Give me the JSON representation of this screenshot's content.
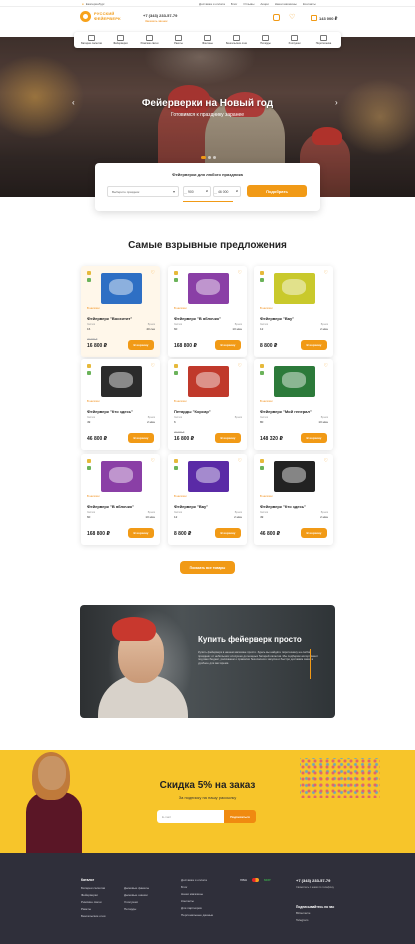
{
  "topbar": {
    "city": "Екатеринбург",
    "links": [
      "Доставка и оплата",
      "Блог",
      "Отзывы",
      "Акции",
      "Наши магазины",
      "Контакты"
    ]
  },
  "header": {
    "logo_line1": "РУССКИЙ",
    "logo_line2": "ФЕЙЕРВЕРК",
    "phone": "+7 (343) 233-57-79",
    "callback": "Заказать звонок",
    "cart_total": "143 000 ₽"
  },
  "categories": [
    "Батареи салютов",
    "Фейерверки",
    "Римские свечи",
    "Ракеты",
    "Фонтаны",
    "Бенгальские огни",
    "Петарды",
    "Хлопушки",
    "Пиротехника"
  ],
  "hero": {
    "title": "Фейерверки на Новый год",
    "subtitle": "Готовимся к празднику заранее"
  },
  "filter": {
    "title": "Фейерверки для любого праздника",
    "select_placeholder": "Выберите праздник",
    "from_value": "900",
    "to_value": "46 000",
    "currency": "₽",
    "button": "Подобрать"
  },
  "offers": {
    "title": "Самые взрывные предложения",
    "stock_label": "В наличии",
    "spec1": "Залпов",
    "spec2": "Время",
    "cart_button": "В корзину",
    "more_button": "Показать все товары",
    "items": [
      {
        "name": "Фейерверк \"Восхитит\"",
        "shots": "16",
        "time": "40 сек",
        "price": "16 800 ₽",
        "old": "20 000 ₽",
        "color": "#2e6fc4"
      },
      {
        "name": "Фейерверк \"В яблочко\"",
        "shots": "60",
        "time": "10 мин",
        "price": "168 800 ₽",
        "old": "",
        "color": "#8a3fa6"
      },
      {
        "name": "Фейерверк \"Вау\"",
        "shots": "12",
        "time": "2 мин",
        "price": "8 800 ₽",
        "old": "",
        "color": "#c9c92c"
      },
      {
        "name": "Фейерверк \"Кто здесь\"",
        "shots": "49",
        "time": "2 мин",
        "price": "46 800 ₽",
        "old": "",
        "color": "#2b2b2b"
      },
      {
        "name": "Петарды \"Корсар\"",
        "shots": "6",
        "time": "",
        "price": "16 800 ₽",
        "old": "20 000 ₽",
        "color": "#c0392b"
      },
      {
        "name": "Фейерверк \"Мой генерал\"",
        "shots": "80",
        "time": "10 мин",
        "price": "148 320 ₽",
        "old": "",
        "color": "#2c7a3a"
      },
      {
        "name": "Фейерверк \"В яблочко\"",
        "shots": "60",
        "time": "10 мин",
        "price": "168 800 ₽",
        "old": "",
        "color": "#8a3fa6"
      },
      {
        "name": "Фейерверк \"Вау\"",
        "shots": "12",
        "time": "2 мин",
        "price": "8 800 ₽",
        "old": "",
        "color": "#5a2aa6"
      },
      {
        "name": "Фейерверк \"Кто здесь\"",
        "shots": "49",
        "time": "2 мин",
        "price": "46 800 ₽",
        "old": "",
        "color": "#222222"
      }
    ]
  },
  "promo": {
    "title": "Купить фейерверк просто",
    "text": "Купить фейерверк в нашем магазине просто. Здесь вы найдёте пиротехнику на любой праздник: от небольших хлопушек до мощных батарей салютов. Мы подберём ассортимент под ваш бюджет, расскажем о правилах безопасного запуска и быстро доставим заказ в удобное для вас время."
  },
  "subscribe": {
    "title": "Скидка 5% на заказ",
    "subtitle": "За подписку на нашу рассылку",
    "placeholder": "E-mail",
    "button": "Подписаться"
  },
  "footer": {
    "heading": "Каталог",
    "col1": [
      "Батареи салютов",
      "Фейерверки",
      "Римские свечи",
      "Ракеты",
      "Бенгальские огни"
    ],
    "col2": [
      "Дымовые факелы",
      "Дымовые шашки",
      "Хлопушки",
      "Петарды"
    ],
    "col3": [
      "Доставка и оплата",
      "Блог",
      "Наши магазины",
      "Контакты",
      "Для партнёров",
      "Персональные данные"
    ],
    "pay": [
      "VISA",
      "МИР"
    ],
    "phone": "+7 (343) 233-57-79",
    "address": "Свяжитесь с нами по телефону",
    "social_title": "Подписывайтесь на нас",
    "social": [
      "ВКонтакте",
      "Telegram"
    ]
  }
}
